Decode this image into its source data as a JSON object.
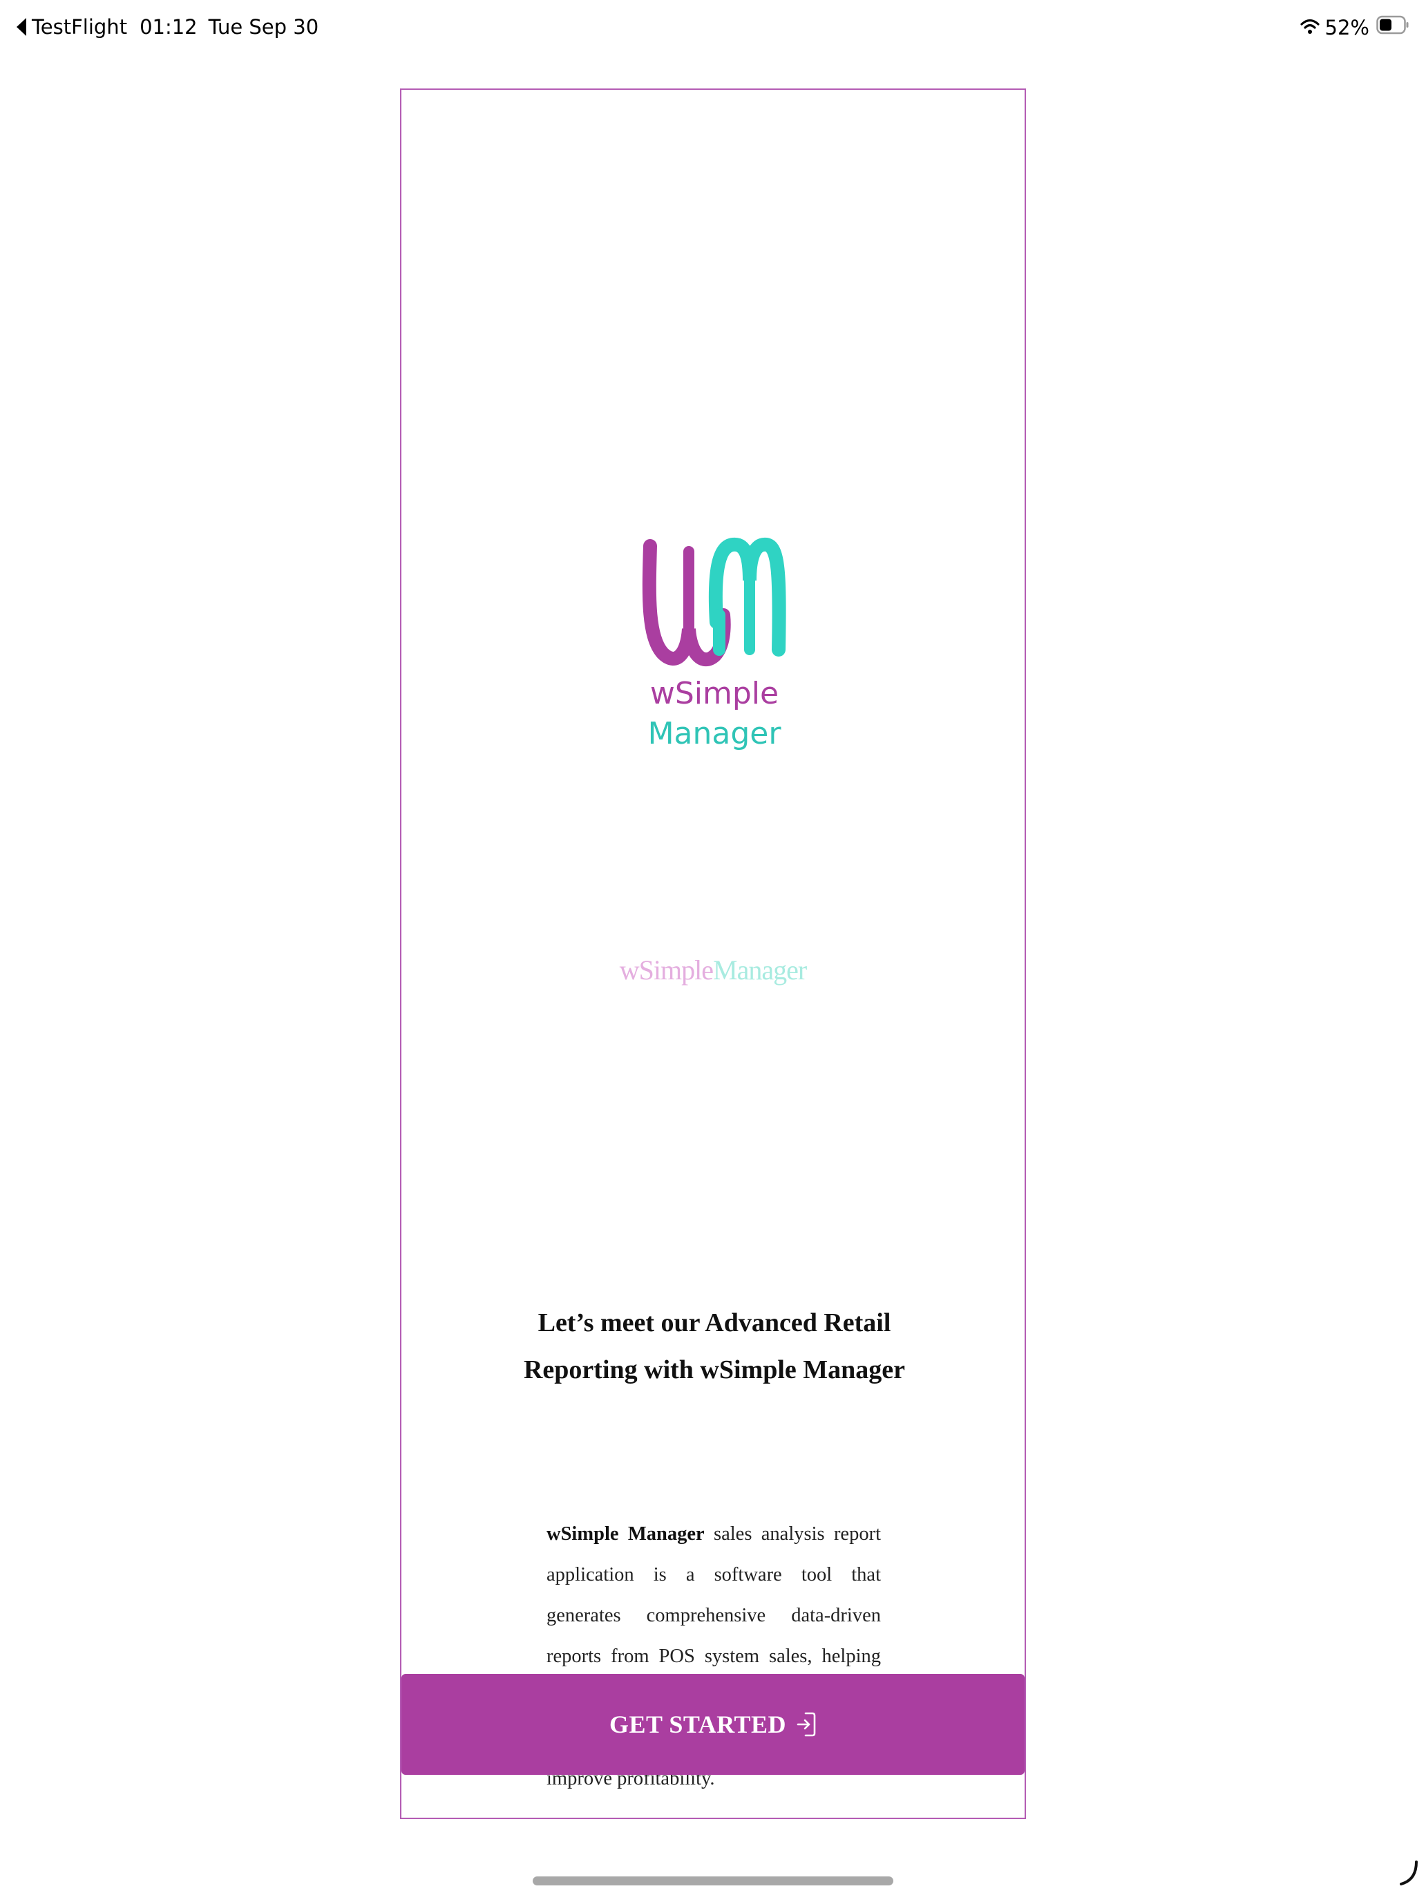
{
  "status_bar": {
    "back_app": "TestFlight",
    "time": "01:12",
    "date": "Tue Sep 30",
    "battery_percent": "52%",
    "battery_level": 0.52
  },
  "app": {
    "logo": {
      "monogram": "WM",
      "line1": "wSimple",
      "line2": "Manager",
      "colors": {
        "purple": "#aa3ea0",
        "teal": "#2fd3c3"
      }
    },
    "brand_inline": {
      "part1": "wSimple",
      "part2": "Manager"
    },
    "headline": {
      "line1": "Let’s meet our Advanced Retail",
      "line2": "Reporting with wSimple Manager"
    },
    "description": {
      "bold": "wSimple Manager",
      "rest": " sales analysis report application is a software tool that generates comprehensive data-driven reports from POS system sales, helping businesses understand performance, identify trends, manage inventory, and improve profitability."
    },
    "button": {
      "label": "GET STARTED",
      "icon": "sign-in-icon"
    }
  },
  "colors": {
    "accent": "#aa3ea0",
    "frame_border": "#b45cb4",
    "teal": "#2fd3c3"
  }
}
